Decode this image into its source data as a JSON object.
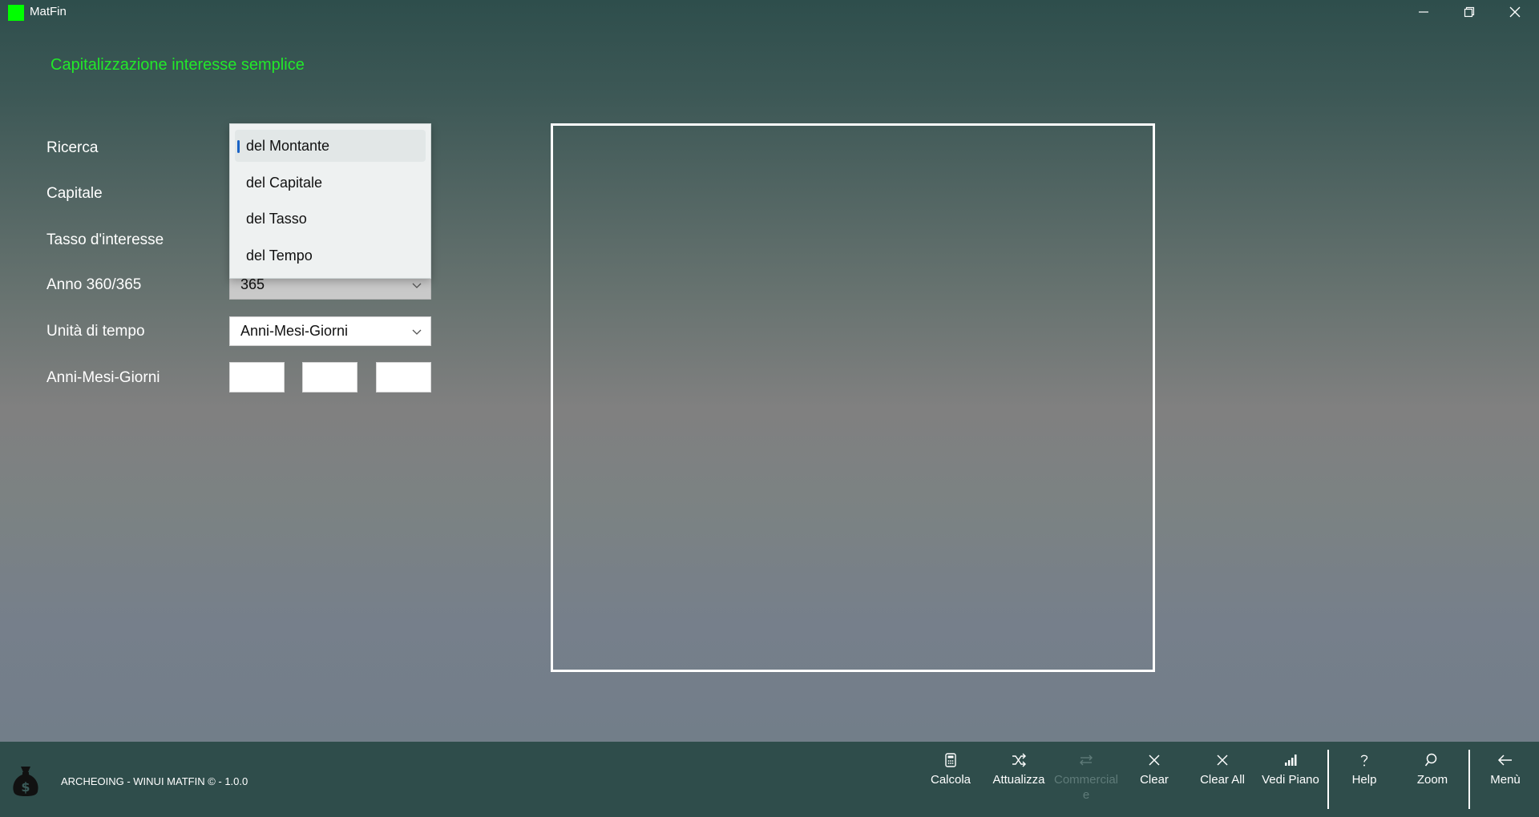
{
  "window": {
    "title": "MatFin"
  },
  "page": {
    "title": "Capitalizzazione interesse semplice"
  },
  "form": {
    "labels": {
      "ricerca": "Ricerca",
      "capitale": "Capitale",
      "tasso": "Tasso d'interesse",
      "anno": "Anno 360/365",
      "unita": "Unità di tempo",
      "amg": "Anni-Mesi-Giorni"
    },
    "anno_value": "365",
    "unita_value": "Anni-Mesi-Giorni"
  },
  "dropdown": {
    "items": [
      "del Montante",
      "del Capitale",
      "del Tasso",
      "del Tempo"
    ],
    "selected": "del Montante"
  },
  "footer": {
    "text": "ARCHEOING - WINUI MATFIN © - 1.0.0"
  },
  "commands": [
    {
      "label": "Calcola",
      "icon": "calculator-icon"
    },
    {
      "label": "Attualizza",
      "icon": "shuffle-icon"
    },
    {
      "label": "Commerciale",
      "icon": "swap-icon",
      "disabled": true
    },
    {
      "label": "Clear",
      "icon": "close-icon"
    },
    {
      "label": "Clear All",
      "icon": "close-icon"
    },
    {
      "label": "Vedi Piano",
      "icon": "signal-bars-icon"
    },
    {
      "label": "Help",
      "icon": "question-icon"
    },
    {
      "label": "Zoom",
      "icon": "search-icon"
    },
    {
      "label": "Menù",
      "icon": "back-arrow-icon"
    }
  ],
  "colors": {
    "accent_green": "#22e82a",
    "app_icon": "#00ff00",
    "commandbar": "#2f4d4b"
  }
}
